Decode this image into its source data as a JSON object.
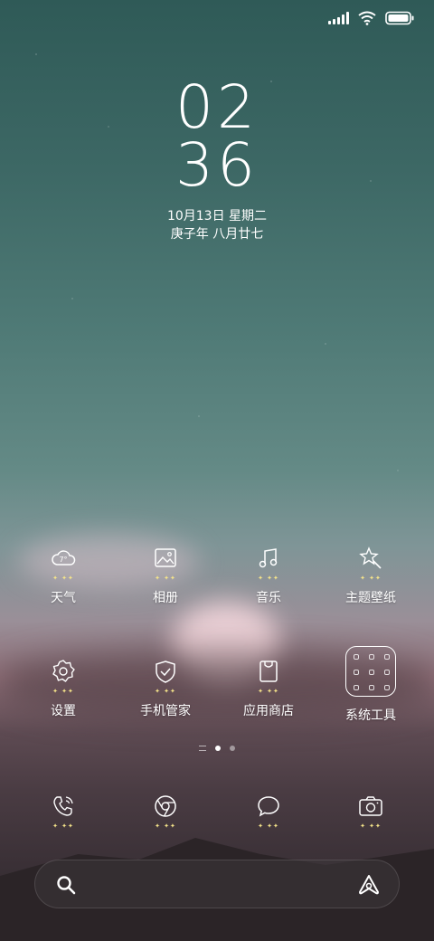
{
  "status_bar": {
    "signal_icon": "signal-icon",
    "wifi_icon": "wifi-icon",
    "battery_icon": "battery-icon"
  },
  "clock": {
    "hours": "02",
    "minutes": "36"
  },
  "date": {
    "line1": "10月13日 星期二",
    "line2": "庚子年 八月廿七"
  },
  "apps_row1": [
    {
      "label": "天气",
      "icon": "weather-icon",
      "badge": "7°"
    },
    {
      "label": "相册",
      "icon": "gallery-icon"
    },
    {
      "label": "音乐",
      "icon": "music-icon"
    },
    {
      "label": "主题壁纸",
      "icon": "themes-icon"
    }
  ],
  "apps_row2": [
    {
      "label": "设置",
      "icon": "settings-icon"
    },
    {
      "label": "手机管家",
      "icon": "security-icon"
    },
    {
      "label": "应用商店",
      "icon": "app-store-icon"
    },
    {
      "label": "系统工具",
      "icon": "folder-icon"
    }
  ],
  "dock": [
    {
      "icon": "phone-icon"
    },
    {
      "icon": "browser-icon"
    },
    {
      "icon": "messages-icon"
    },
    {
      "icon": "camera-icon"
    }
  ],
  "pager": {
    "active_index": 1
  },
  "search_bar": {
    "search_icon": "search-icon",
    "assistant_icon": "assistant-icon"
  },
  "colors": {
    "sparkle": "#f5e48a",
    "text": "#ffffff"
  }
}
